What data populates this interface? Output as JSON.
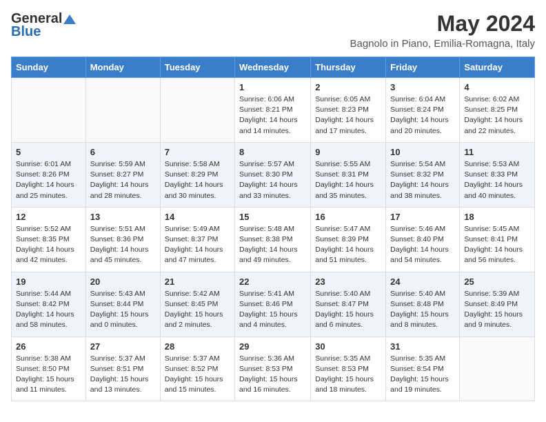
{
  "header": {
    "logo_general": "General",
    "logo_blue": "Blue",
    "main_title": "May 2024",
    "subtitle": "Bagnolo in Piano, Emilia-Romagna, Italy"
  },
  "days_of_week": [
    "Sunday",
    "Monday",
    "Tuesday",
    "Wednesday",
    "Thursday",
    "Friday",
    "Saturday"
  ],
  "weeks": [
    [
      {
        "day": "",
        "info": ""
      },
      {
        "day": "",
        "info": ""
      },
      {
        "day": "",
        "info": ""
      },
      {
        "day": "1",
        "info": "Sunrise: 6:06 AM\nSunset: 8:21 PM\nDaylight: 14 hours\nand 14 minutes."
      },
      {
        "day": "2",
        "info": "Sunrise: 6:05 AM\nSunset: 8:23 PM\nDaylight: 14 hours\nand 17 minutes."
      },
      {
        "day": "3",
        "info": "Sunrise: 6:04 AM\nSunset: 8:24 PM\nDaylight: 14 hours\nand 20 minutes."
      },
      {
        "day": "4",
        "info": "Sunrise: 6:02 AM\nSunset: 8:25 PM\nDaylight: 14 hours\nand 22 minutes."
      }
    ],
    [
      {
        "day": "5",
        "info": "Sunrise: 6:01 AM\nSunset: 8:26 PM\nDaylight: 14 hours\nand 25 minutes."
      },
      {
        "day": "6",
        "info": "Sunrise: 5:59 AM\nSunset: 8:27 PM\nDaylight: 14 hours\nand 28 minutes."
      },
      {
        "day": "7",
        "info": "Sunrise: 5:58 AM\nSunset: 8:29 PM\nDaylight: 14 hours\nand 30 minutes."
      },
      {
        "day": "8",
        "info": "Sunrise: 5:57 AM\nSunset: 8:30 PM\nDaylight: 14 hours\nand 33 minutes."
      },
      {
        "day": "9",
        "info": "Sunrise: 5:55 AM\nSunset: 8:31 PM\nDaylight: 14 hours\nand 35 minutes."
      },
      {
        "day": "10",
        "info": "Sunrise: 5:54 AM\nSunset: 8:32 PM\nDaylight: 14 hours\nand 38 minutes."
      },
      {
        "day": "11",
        "info": "Sunrise: 5:53 AM\nSunset: 8:33 PM\nDaylight: 14 hours\nand 40 minutes."
      }
    ],
    [
      {
        "day": "12",
        "info": "Sunrise: 5:52 AM\nSunset: 8:35 PM\nDaylight: 14 hours\nand 42 minutes."
      },
      {
        "day": "13",
        "info": "Sunrise: 5:51 AM\nSunset: 8:36 PM\nDaylight: 14 hours\nand 45 minutes."
      },
      {
        "day": "14",
        "info": "Sunrise: 5:49 AM\nSunset: 8:37 PM\nDaylight: 14 hours\nand 47 minutes."
      },
      {
        "day": "15",
        "info": "Sunrise: 5:48 AM\nSunset: 8:38 PM\nDaylight: 14 hours\nand 49 minutes."
      },
      {
        "day": "16",
        "info": "Sunrise: 5:47 AM\nSunset: 8:39 PM\nDaylight: 14 hours\nand 51 minutes."
      },
      {
        "day": "17",
        "info": "Sunrise: 5:46 AM\nSunset: 8:40 PM\nDaylight: 14 hours\nand 54 minutes."
      },
      {
        "day": "18",
        "info": "Sunrise: 5:45 AM\nSunset: 8:41 PM\nDaylight: 14 hours\nand 56 minutes."
      }
    ],
    [
      {
        "day": "19",
        "info": "Sunrise: 5:44 AM\nSunset: 8:42 PM\nDaylight: 14 hours\nand 58 minutes."
      },
      {
        "day": "20",
        "info": "Sunrise: 5:43 AM\nSunset: 8:44 PM\nDaylight: 15 hours\nand 0 minutes."
      },
      {
        "day": "21",
        "info": "Sunrise: 5:42 AM\nSunset: 8:45 PM\nDaylight: 15 hours\nand 2 minutes."
      },
      {
        "day": "22",
        "info": "Sunrise: 5:41 AM\nSunset: 8:46 PM\nDaylight: 15 hours\nand 4 minutes."
      },
      {
        "day": "23",
        "info": "Sunrise: 5:40 AM\nSunset: 8:47 PM\nDaylight: 15 hours\nand 6 minutes."
      },
      {
        "day": "24",
        "info": "Sunrise: 5:40 AM\nSunset: 8:48 PM\nDaylight: 15 hours\nand 8 minutes."
      },
      {
        "day": "25",
        "info": "Sunrise: 5:39 AM\nSunset: 8:49 PM\nDaylight: 15 hours\nand 9 minutes."
      }
    ],
    [
      {
        "day": "26",
        "info": "Sunrise: 5:38 AM\nSunset: 8:50 PM\nDaylight: 15 hours\nand 11 minutes."
      },
      {
        "day": "27",
        "info": "Sunrise: 5:37 AM\nSunset: 8:51 PM\nDaylight: 15 hours\nand 13 minutes."
      },
      {
        "day": "28",
        "info": "Sunrise: 5:37 AM\nSunset: 8:52 PM\nDaylight: 15 hours\nand 15 minutes."
      },
      {
        "day": "29",
        "info": "Sunrise: 5:36 AM\nSunset: 8:53 PM\nDaylight: 15 hours\nand 16 minutes."
      },
      {
        "day": "30",
        "info": "Sunrise: 5:35 AM\nSunset: 8:53 PM\nDaylight: 15 hours\nand 18 minutes."
      },
      {
        "day": "31",
        "info": "Sunrise: 5:35 AM\nSunset: 8:54 PM\nDaylight: 15 hours\nand 19 minutes."
      },
      {
        "day": "",
        "info": ""
      }
    ]
  ]
}
